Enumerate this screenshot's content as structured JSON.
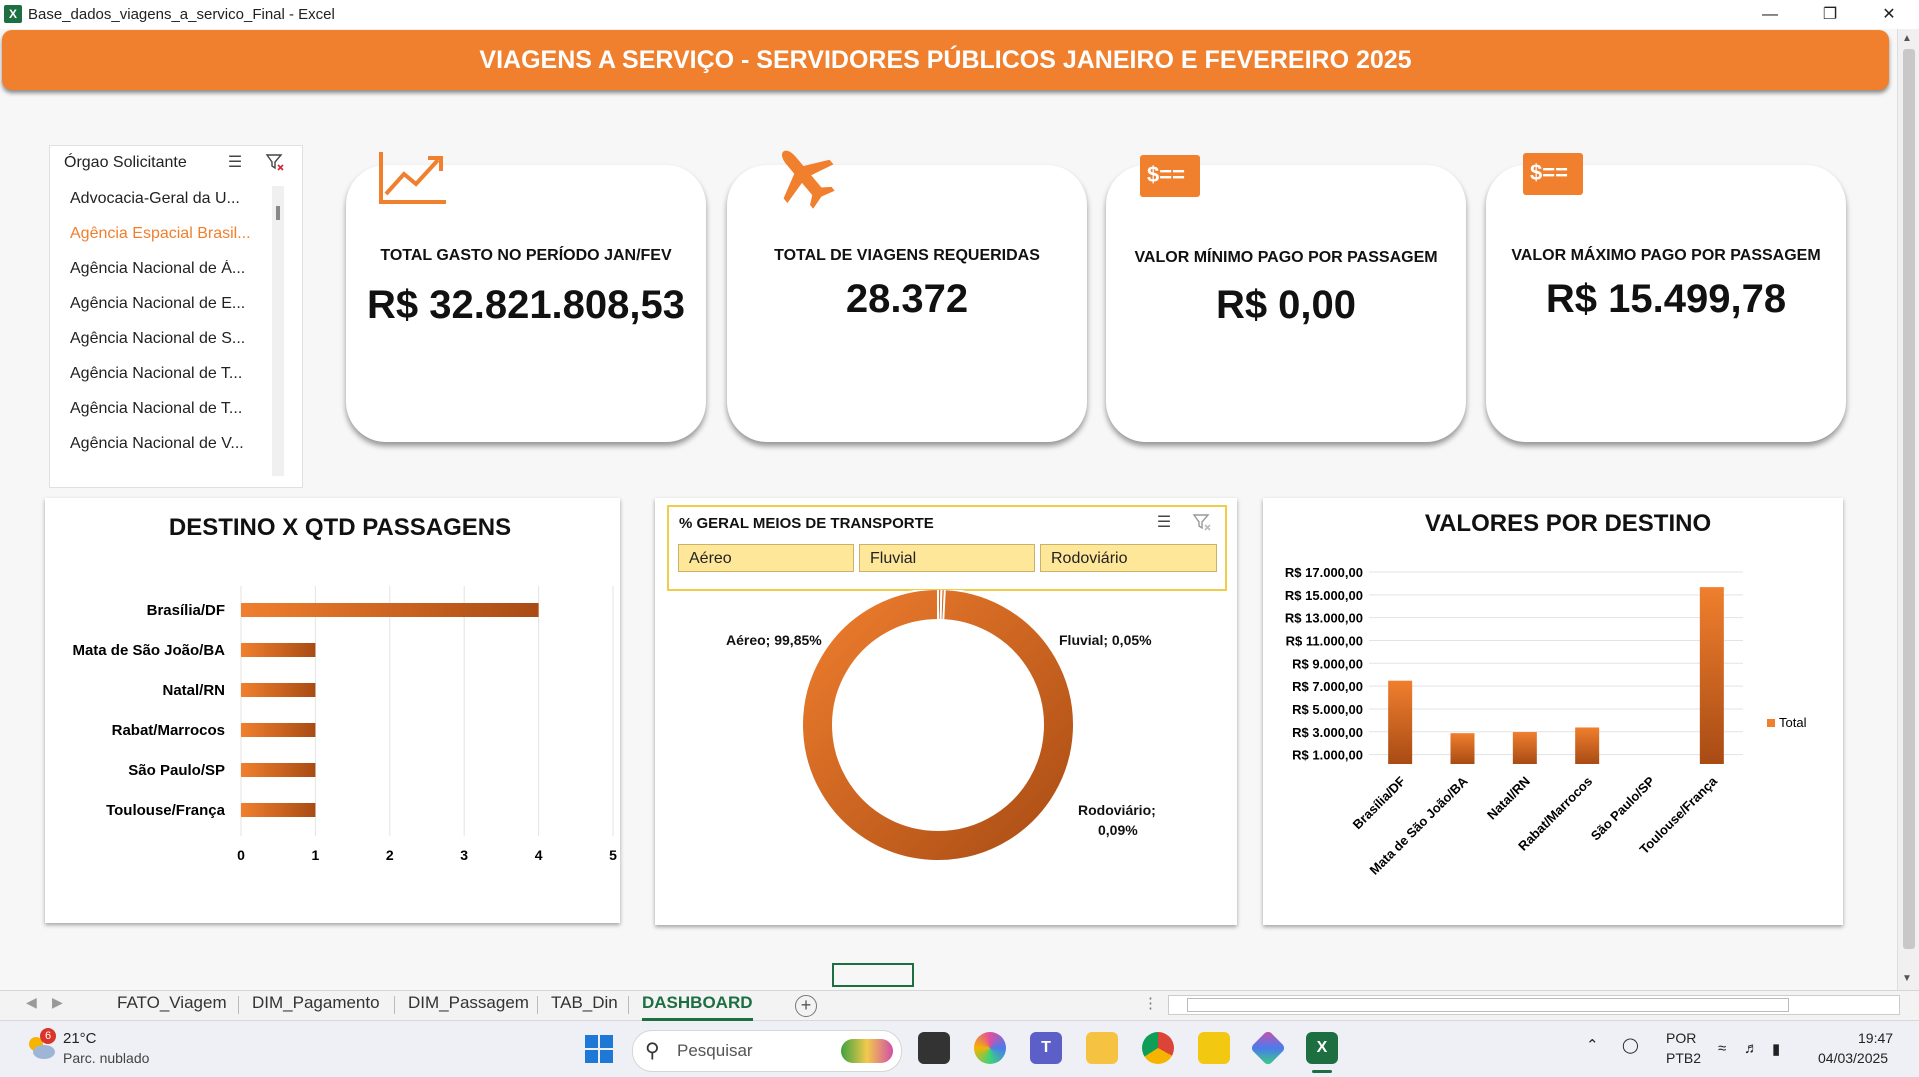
{
  "window": {
    "title": "Base_dados_viagens_a_servico_Final - Excel",
    "app_logo": "X"
  },
  "banner": {
    "title": "VIAGENS A SERVIÇO - SERVIDORES PÚBLICOS JANEIRO E FEVEREIRO 2025"
  },
  "slicer": {
    "header": "Órgao Solicitante",
    "items": [
      "Advocacia-Geral da U...",
      "Agência Espacial Brasil...",
      "Agência Nacional de Á...",
      "Agência Nacional de E...",
      "Agência Nacional de S...",
      "Agência Nacional de T...",
      "Agência Nacional de T...",
      "Agência Nacional de V..."
    ],
    "selected_index": 1
  },
  "kpis": [
    {
      "label": "TOTAL GASTO NO PERÍODO JAN/FEV",
      "value": "R$ 32.821.808,53",
      "icon": "trend-up-icon"
    },
    {
      "label": "TOTAL DE VIAGENS REQUERIDAS",
      "value": "28.372",
      "icon": "airplane-icon"
    },
    {
      "label": "VALOR MÍNIMO PAGO POR PASSAGEM",
      "value": "R$ 0,00",
      "icon": "money-icon",
      "icon_text": "$=="
    },
    {
      "label": "VALOR MÁXIMO PAGO POR PASSAGEM",
      "value": "R$ 15.499,78",
      "icon": "money-icon",
      "icon_text": "$=="
    }
  ],
  "colors": {
    "accent": "#f07f2e",
    "accent_dark": "#a84b14",
    "excel_green": "#1d6f42",
    "chip": "#ffe79a"
  },
  "chart_data": [
    {
      "type": "bar",
      "orientation": "horizontal",
      "title": "DESTINO X  QTD PASSAGENS",
      "categories": [
        "Brasília/DF",
        "Mata de São João/BA",
        "Natal/RN",
        "Rabat/Marrocos",
        "São Paulo/SP",
        "Toulouse/França"
      ],
      "values": [
        4,
        1,
        1,
        1,
        1,
        1
      ],
      "xlim": [
        0,
        5
      ],
      "xticks": [
        "0",
        "1",
        "2",
        "3",
        "4",
        "5"
      ],
      "grid": true
    },
    {
      "type": "pie",
      "variant": "donut",
      "title": "% GERAL MEIOS DE TRANSPORTE",
      "filters": [
        "Aéreo",
        "Fluvial",
        "Rodoviário"
      ],
      "slices": [
        {
          "name": "Aéreo",
          "value": 99.85,
          "label": "Aéreo; 99,85%"
        },
        {
          "name": "Fluvial",
          "value": 0.05,
          "label": "Fluvial; 0,05%"
        },
        {
          "name": "Rodoviário",
          "value": 0.09,
          "label_line1": "Rodoviário;",
          "label_line2": "0,09%"
        }
      ]
    },
    {
      "type": "bar",
      "orientation": "vertical",
      "title": "VALORES POR DESTINO",
      "categories": [
        "Brasília/DF",
        "Mata de São João/BA",
        "Natal/RN",
        "Rabat/Marrocos",
        "São Paulo/SP",
        "Toulouse/França"
      ],
      "values": [
        7300,
        2700,
        2800,
        3200,
        0,
        15499.78
      ],
      "ylim": [
        0,
        17000
      ],
      "yticks": [
        "R$ 17.000,00",
        "R$ 15.000,00",
        "R$ 13.000,00",
        "R$ 11.000,00",
        "R$ 9.000,00",
        "R$ 7.000,00",
        "R$ 5.000,00",
        "R$ 3.000,00",
        "R$ 1.000,00"
      ],
      "ytick_values": [
        17000,
        15000,
        13000,
        11000,
        9000,
        7000,
        5000,
        3000,
        1000
      ],
      "legend": "Total",
      "legend_position": "right",
      "grid": true
    }
  ],
  "sheet_tabs": [
    "FATO_Viagem",
    "DIM_Pagamento",
    "DIM_Passagem",
    "TAB_Din",
    "DASHBOARD"
  ],
  "active_tab": "DASHBOARD",
  "taskbar": {
    "weather_temp": "21°C",
    "weather_desc": "Parc. nublado",
    "weather_badge": "6",
    "search_placeholder": "Pesquisar",
    "lang_line1": "POR",
    "lang_line2": "PTB2",
    "time": "19:47",
    "date": "04/03/2025"
  }
}
